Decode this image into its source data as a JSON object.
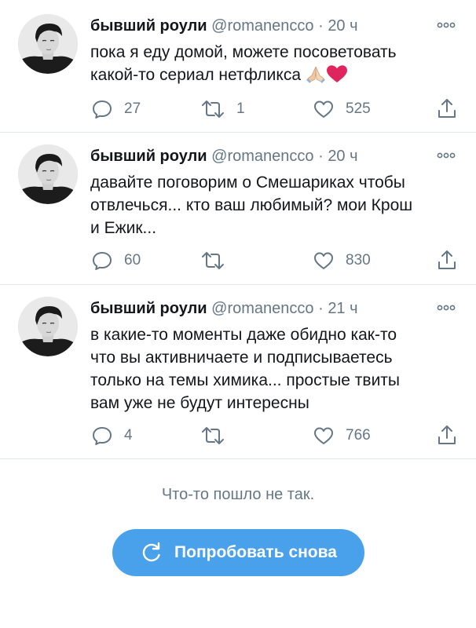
{
  "tweets": [
    {
      "name": "бывший роули",
      "handle": "@romanencco",
      "dot": "·",
      "time": "20 ч",
      "lines": [
        "пока я еду домой, можете посоветовать",
        "какой-то сериал нетфликса"
      ],
      "emoji": [
        "folded-hands",
        "red-heart"
      ],
      "replies": "27",
      "retweets": "1",
      "likes": "525"
    },
    {
      "name": "бывший роули",
      "handle": "@romanencco",
      "dot": "·",
      "time": "20 ч",
      "lines": [
        "давайте поговорим о Смешариках чтобы",
        "отвлечься... кто ваш любимый? мои Крош",
        "и Ежик..."
      ],
      "replies": "60",
      "retweets": "",
      "likes": "830"
    },
    {
      "name": "бывший роули",
      "handle": "@romanencco",
      "dot": "·",
      "time": "21 ч",
      "lines": [
        "в какие-то моменты даже обидно как-то",
        "что вы активничаете и подписываетесь",
        "только на темы химика... простые твиты",
        "вам уже не будут интересны"
      ],
      "replies": "4",
      "retweets": "",
      "likes": "766"
    }
  ],
  "error_message": "Что-то пошло не так.",
  "retry_label": "Попробовать снова",
  "colors": {
    "accent": "#4aa1eb",
    "muted": "#657786",
    "text": "#14171a",
    "divider": "#e1e8ed",
    "heart": "#e0245e"
  }
}
